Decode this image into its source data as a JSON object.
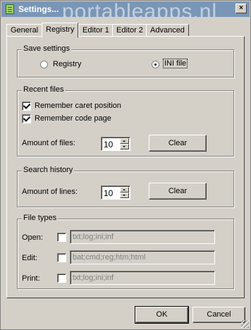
{
  "window": {
    "title": "Settings...",
    "watermark": "portableapps.nl",
    "close_glyph": "×"
  },
  "tabs": [
    {
      "label": "General",
      "active": false
    },
    {
      "label": "Registry",
      "active": true
    },
    {
      "label": "Editor 1",
      "active": false
    },
    {
      "label": "Editor 2",
      "active": false
    },
    {
      "label": "Advanced",
      "active": false
    }
  ],
  "save_settings": {
    "title": "Save settings",
    "options": [
      {
        "label": "Registry",
        "selected": false
      },
      {
        "label": "INI file",
        "selected": true
      }
    ]
  },
  "recent_files": {
    "title": "Recent files",
    "remember_caret": {
      "label": "Remember caret position",
      "checked": true
    },
    "remember_codepage": {
      "label": "Remember code page",
      "checked": true
    },
    "amount_label": "Amount of files:",
    "amount_value": "10",
    "clear_label": "Clear"
  },
  "search_history": {
    "title": "Search history",
    "amount_label": "Amount of lines:",
    "amount_value": "10",
    "clear_label": "Clear"
  },
  "file_types": {
    "title": "File types",
    "rows": [
      {
        "label": "Open:",
        "checked": false,
        "value": "txt;log;ini;inf"
      },
      {
        "label": "Edit:",
        "checked": false,
        "value": "bat;cmd;reg;htm;html"
      },
      {
        "label": "Print:",
        "checked": false,
        "value": "txt;log;ini;inf"
      }
    ]
  },
  "footer": {
    "ok_label": "OK",
    "cancel_label": "Cancel"
  }
}
